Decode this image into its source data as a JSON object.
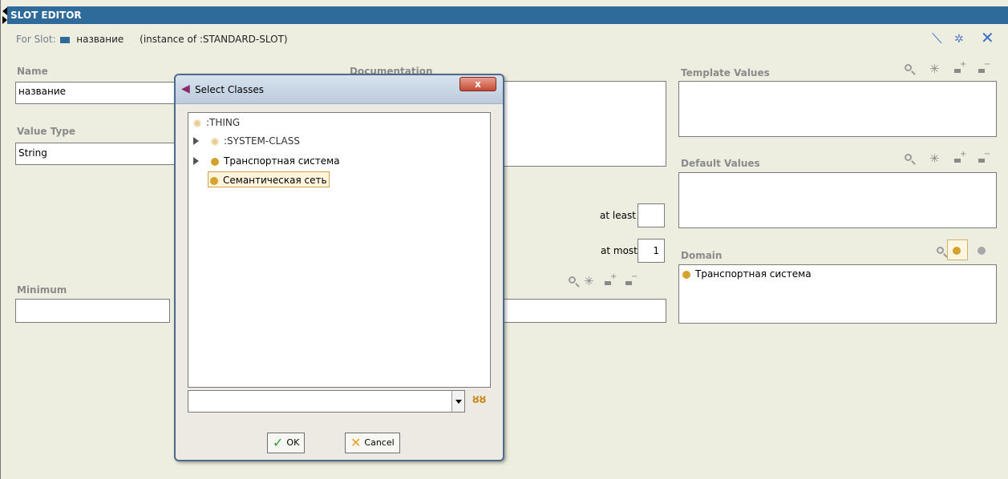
{
  "editor": {
    "title": "SLOT EDITOR",
    "for_slot_label": "For Slot:",
    "slot_name": "название",
    "instance_of": "(instance of :STANDARD-SLOT)",
    "name_label": "Name",
    "name_value": "название",
    "documentation_label": "Documentation",
    "value_type_label": "Value Type",
    "value_type_value": "String",
    "at_least_label": "at least",
    "at_least_value": "",
    "at_most_label": "at most",
    "at_most_value": "1",
    "minimum_label": "Minimum",
    "minimum_value": "",
    "template_values_label": "Template Values",
    "default_values_label": "Default Values",
    "domain_label": "Domain",
    "domain_items": [
      "Транспортная система"
    ]
  },
  "dialog": {
    "title": "Select Classes",
    "close_label": "x",
    "tree": [
      {
        "label": ":THING",
        "style": "light",
        "expandable": false
      },
      {
        "label": ":SYSTEM-CLASS",
        "style": "light",
        "expandable": true
      },
      {
        "label": "Транспортная система",
        "style": "normal",
        "expandable": true
      },
      {
        "label": "Семантическая сеть",
        "style": "normal",
        "expandable": false,
        "selected": true
      }
    ],
    "search_value": "",
    "ok_label": "OK",
    "cancel_label": "Cancel"
  },
  "colors": {
    "title_bar": "#2f6b9a",
    "background": "#eeeee0",
    "class_bullet": "#d4a22d"
  },
  "icons": [
    "pin-icon",
    "filter-icon",
    "close-icon",
    "search-icon",
    "delete-icon",
    "add-icon",
    "remove-icon",
    "binoculars-icon",
    "check-icon",
    "cancel-icon"
  ]
}
